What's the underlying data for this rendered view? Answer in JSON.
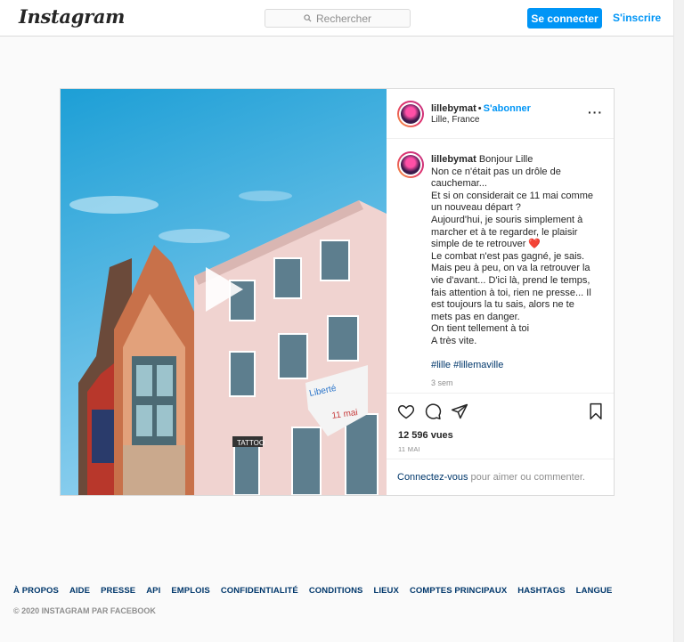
{
  "header": {
    "logo": "Instagram",
    "search_placeholder": "Rechercher",
    "login_label": "Se connecter",
    "signup_label": "S'inscrire"
  },
  "post": {
    "username": "lillebymat",
    "follow_label": "S'abonner",
    "location": "Lille, France",
    "caption_lines": [
      "Bonjour Lille",
      "Non ce n'était pas un drôle de",
      "cauchemar...",
      "Et si on considerait ce 11 mai comme",
      "un nouveau départ ?",
      "Aujourd'hui, je souris simplement à",
      "marcher et à te regarder, le plaisir",
      "simple de te retrouver ❤️",
      "Le combat n'est pas gagné, je sais.",
      "Mais peu à peu, on va la retrouver la",
      "vie d'avant... D'ici là, prend le temps,",
      "fais attention à toi, rien ne presse... Il",
      "est toujours la tu sais, alors ne te",
      "mets pas en danger.",
      "On tient tellement à toi",
      "A très vite."
    ],
    "hashtags": [
      "#lille",
      "#lillemaville"
    ],
    "time_ago": "3 sem",
    "views": "12 596 vues",
    "date": "11 MAI",
    "login_prompt": {
      "link": "Connectez-vous",
      "rest": " pour aimer ou commenter."
    },
    "banner_text": [
      "Liberté",
      "11 mai"
    ],
    "sign_text": "TATTOO"
  },
  "footer": {
    "links": [
      "À PROPOS",
      "AIDE",
      "PRESSE",
      "API",
      "EMPLOIS",
      "CONFIDENTIALITÉ",
      "CONDITIONS",
      "LIEUX",
      "COMPTES PRINCIPAUX",
      "HASHTAGS",
      "LANGUE"
    ],
    "copyright": "© 2020 INSTAGRAM PAR FACEBOOK"
  },
  "colors": {
    "accent": "#0095f6",
    "link": "#00376b",
    "heart": "#ed4956"
  }
}
